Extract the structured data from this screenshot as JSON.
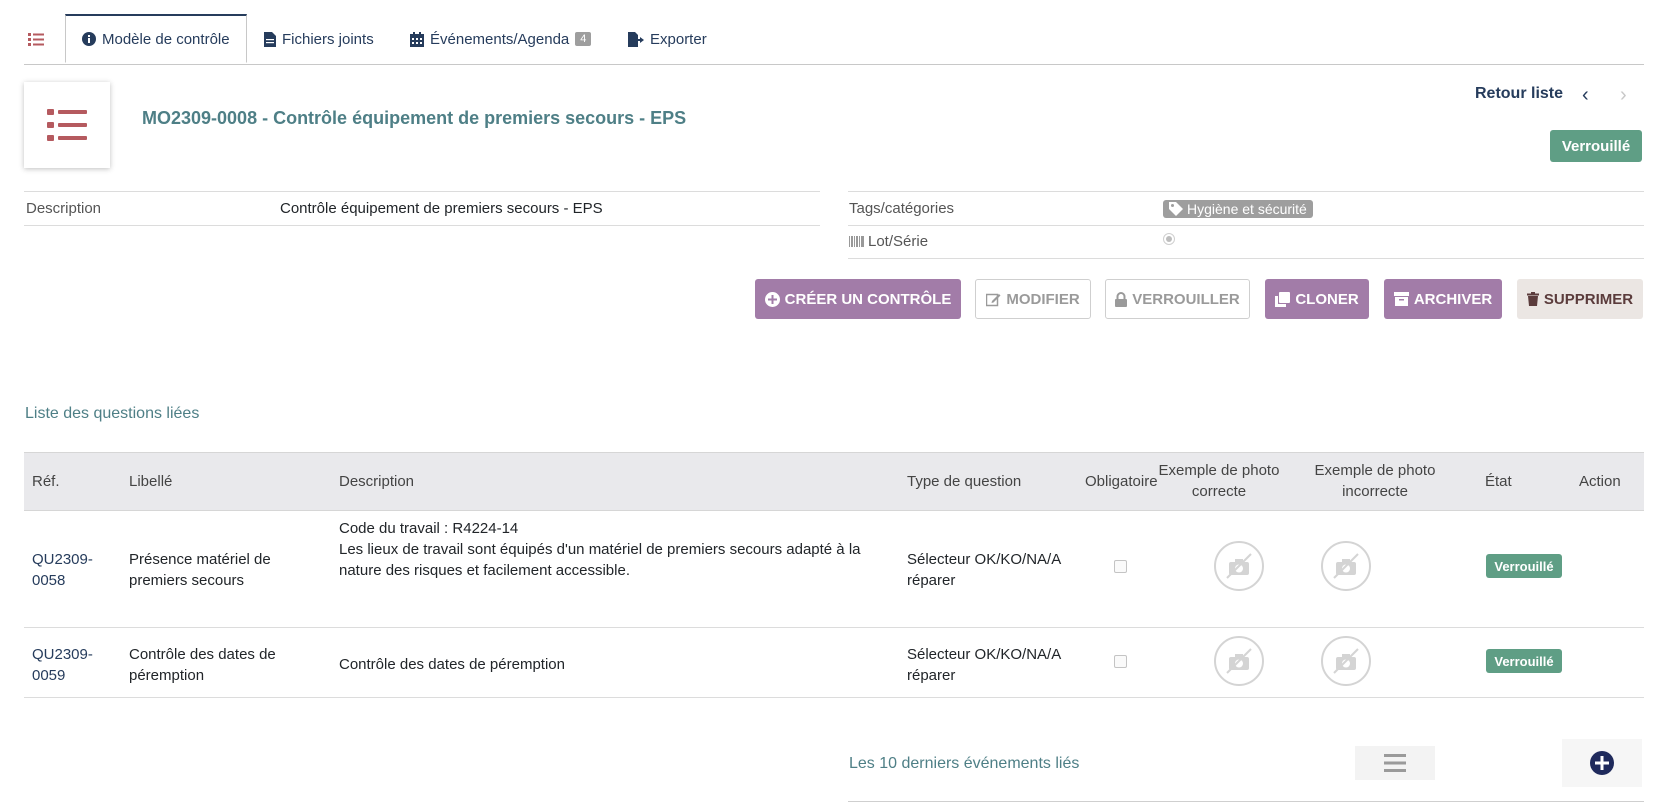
{
  "tabs": [
    {
      "label": ""
    },
    {
      "label": "Modèle de contrôle"
    },
    {
      "label": "Fichiers joints"
    },
    {
      "label": "Événements/Agenda",
      "count": "4"
    },
    {
      "label": "Exporter"
    }
  ],
  "header": {
    "title": "MO2309-0008 - Contrôle équipement de premiers secours - EPS",
    "back_label": "Retour liste",
    "status": "Verrouillé"
  },
  "fields": {
    "description_label": "Description",
    "description_value": "Contrôle équipement de premiers secours - EPS",
    "tags_label": "Tags/catégories",
    "tag_value": "Hygiène et sécurité",
    "lot_label": "Lot/Série"
  },
  "actions": {
    "create": "CRÉER UN CONTRÔLE",
    "modify": "MODIFIER",
    "lock": "VERROUILLER",
    "clone": "CLONER",
    "archive": "ARCHIVER",
    "delete": "SUPPRIMER"
  },
  "questions": {
    "title": "Liste des questions liées",
    "columns": {
      "ref": "Réf.",
      "label": "Libellé",
      "description": "Description",
      "type": "Type de question",
      "mandatory": "Obligatoire",
      "photo_ok_1": "Exemple de photo",
      "photo_ok_2": "correcte",
      "photo_ko_1": "Exemple de photo",
      "photo_ko_2": "incorrecte",
      "state": "État",
      "action": "Action"
    },
    "rows": [
      {
        "ref_1": "QU2309-",
        "ref_2": "0058",
        "label_1": "Présence matériel de",
        "label_2": "premiers secours",
        "desc_1": "Code du travail : R4224-14",
        "desc_2": "Les lieux de travail sont équipés d'un matériel de premiers secours adapté à la",
        "desc_3": "nature des risques et facilement accessible.",
        "type_1": "Sélecteur OK/KO/NA/A",
        "type_2": "réparer",
        "state": "Verrouillé"
      },
      {
        "ref_1": "QU2309-",
        "ref_2": "0059",
        "label_1": "Contrôle des dates de",
        "label_2": "péremption",
        "desc_1": "Contrôle des dates de péremption",
        "type_1": "Sélecteur OK/KO/NA/A",
        "type_2": "réparer",
        "state": "Verrouillé"
      }
    ]
  },
  "events": {
    "title": "Les 10 derniers événements liés"
  },
  "colors": {
    "accent_purple": "#a27ca8",
    "status_green": "#5f9e85",
    "title_teal": "#4e7f86",
    "navy": "#263c5c",
    "logo_red": "#b55a5f"
  }
}
